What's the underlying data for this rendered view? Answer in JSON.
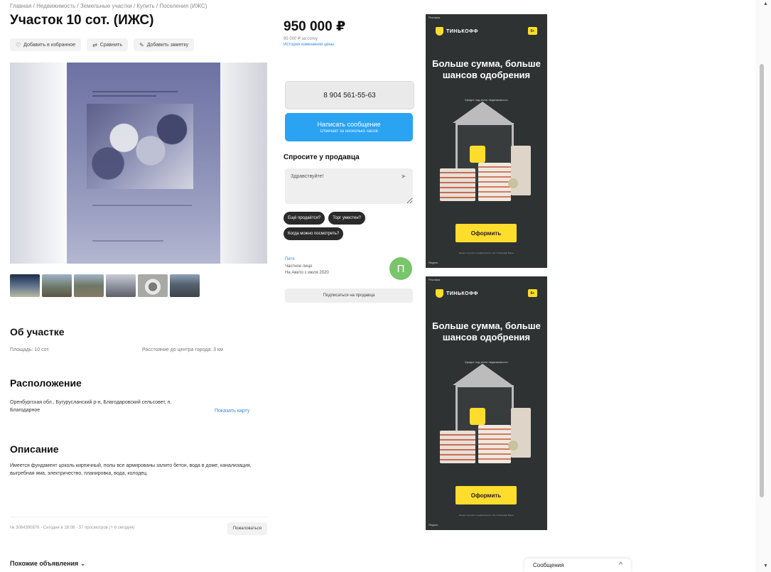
{
  "breadcrumbs": "Главная / Недвижимость / Земельные участки / Купить / Поселения (ИЖС)",
  "listing": {
    "title": "Участок 10 сот. (ИЖС)",
    "actions": {
      "favorite_label": "Добавить в избранное",
      "compare_label": "Сравнить",
      "note_label": "Добавить заметку"
    },
    "thumbnails_count": 6
  },
  "about": {
    "heading": "Об участке",
    "area": "Площадь: 10 сот.",
    "distance": "Расстояние до центра города: 3 км"
  },
  "location": {
    "heading": "Расположение",
    "address": "Оренбургская обл., Бугурусланский р-н, Благодаровский сельсовет, п. Благодарное",
    "show_map_label": "Показать карту"
  },
  "description": {
    "heading": "Описание",
    "text": "Имеется фундамент цоколь кирпичный, полы все армированы залито бетон, вода в доме, канализация, выгребная яма, электричество, планировка, вода, колодец."
  },
  "meta": {
    "text": "№ 3064390876 · Сегодня в 18:08 · 37 просмотров (+ 6 сегодня)",
    "complain_label": "Пожаловаться"
  },
  "similar_label": "Похожие объявления ⌄",
  "price": {
    "value": "950 000 ₽",
    "per_unit": "95 000 ₽ за сотку",
    "history_link": "История изменения цены"
  },
  "contact": {
    "phone": "8 904 561-55-63",
    "message_label": "Написать сообщение",
    "message_sub": "Отвечает за несколько часов"
  },
  "ask": {
    "heading": "Спросите у продавца",
    "input_value": "Здравствуйте!",
    "chips": [
      "Ещё продаётся?",
      "Торг уместен?",
      "Когда можно посмотреть?"
    ]
  },
  "seller": {
    "name": "Петя",
    "type": "Частное лицо",
    "since": "На Авито с июля 2020",
    "avatar_letter": "П",
    "avatar_color": "#79c46c",
    "subscribe_label": "Подписаться на продавца"
  },
  "ads": [
    {
      "tag": "Реклама",
      "brand": "ТИНЬКОФФ",
      "age": "6+",
      "headline": "Больше сумма, больше шансов одобрения",
      "subline": "Кредит под залог недвижимости",
      "cta": "Оформить",
      "fine_print": "Кредит под залог недвижимости. АО «Тинькофф Банк»",
      "corner": "Яндекс",
      "accent": "#ffdd2d"
    },
    {
      "tag": "Реклама",
      "brand": "ТИНЬКОФФ",
      "age": "6+",
      "headline": "Больше сумма, больше шансов одобрения",
      "subline": "Кредит под залог недвижимости",
      "cta": "Оформить",
      "fine_print": "Кредит под залог недвижимости. АО «Тинькофф Банк»",
      "corner": "Яндекс",
      "accent": "#ffdd2d"
    }
  ],
  "chat": {
    "label": "Сообщения",
    "chevron": "^"
  },
  "icons": {
    "favorite": "heart-icon",
    "compare": "compare-icon",
    "note": "note-icon",
    "send": "send-icon"
  },
  "colors": {
    "primary_button": "#2aa3f2",
    "link": "#3a8ad6",
    "ad_background": "#2f3233"
  }
}
